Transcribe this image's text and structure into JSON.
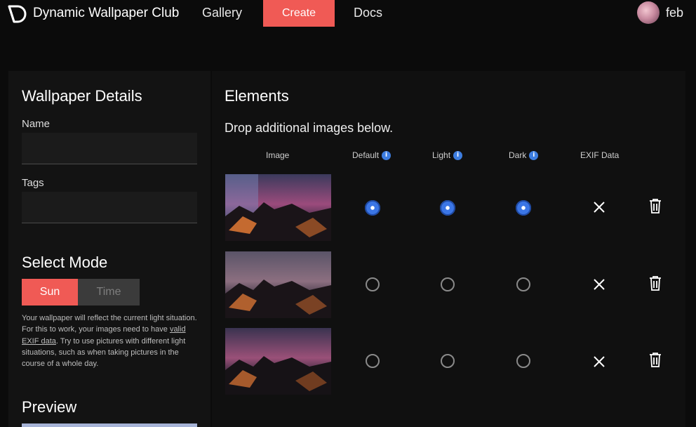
{
  "nav": {
    "brand": "Dynamic Wallpaper Club",
    "links": [
      "Gallery",
      "Create",
      "Docs"
    ],
    "active": "Create",
    "username": "feb",
    "accent_color": "#f05a55"
  },
  "details": {
    "heading": "Wallpaper Details",
    "name_label": "Name",
    "name_value": "",
    "tags_label": "Tags",
    "tags_value": ""
  },
  "mode": {
    "heading": "Select Mode",
    "options": [
      "Sun",
      "Time"
    ],
    "selected": "Sun",
    "help_before": "Your wallpaper will reflect the current light situation. For this to work, your images need to have ",
    "help_link": "valid EXIF data",
    "help_after": ". Try to use pictures with different light situations, such as when taking pictures in the course of a whole day."
  },
  "preview": {
    "heading": "Preview"
  },
  "elements": {
    "heading": "Elements",
    "subtitle": "Drop additional images below.",
    "columns": [
      "Image",
      "Default",
      "Light",
      "Dark",
      "EXIF Data"
    ],
    "info_icon_label": "i",
    "rows": [
      {
        "default": true,
        "light": true,
        "dark": true,
        "exif": false
      },
      {
        "default": false,
        "light": false,
        "dark": false,
        "exif": false
      },
      {
        "default": false,
        "light": false,
        "dark": false,
        "exif": false
      }
    ]
  }
}
